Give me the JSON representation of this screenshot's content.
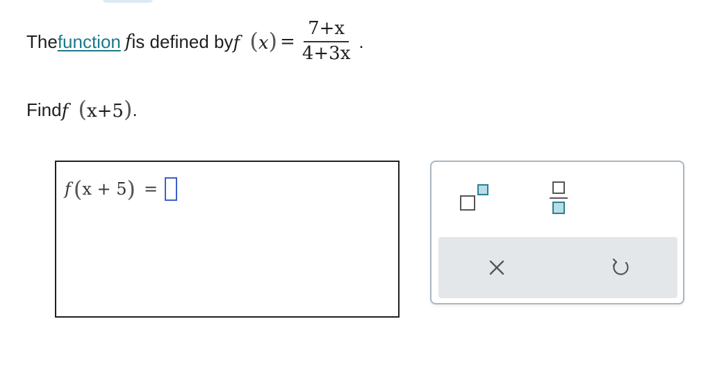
{
  "problem": {
    "intro_pre": "The ",
    "intro_link": "function",
    "intro_post": " is defined by ",
    "func_name": "f",
    "var": "x",
    "equals": "=",
    "numerator": "7+x",
    "denominator": "4+3x",
    "period": ".",
    "find_label": "Find ",
    "find_arg": "x+5"
  },
  "answer": {
    "lhs_func": "f",
    "lhs_arg": "x + 5",
    "equals": "="
  },
  "palette": {
    "exponent_button": "exponent-template-icon",
    "fraction_button": "fraction-template-icon",
    "clear_button": "clear-icon",
    "undo_button": "undo-icon"
  },
  "colors": {
    "link": "#1a7a8c",
    "slot_border": "#3a5fd0",
    "palette_border": "#aab6c0",
    "action_bar_bg": "#e3e7ea",
    "template_fill": "#b7dde6"
  }
}
